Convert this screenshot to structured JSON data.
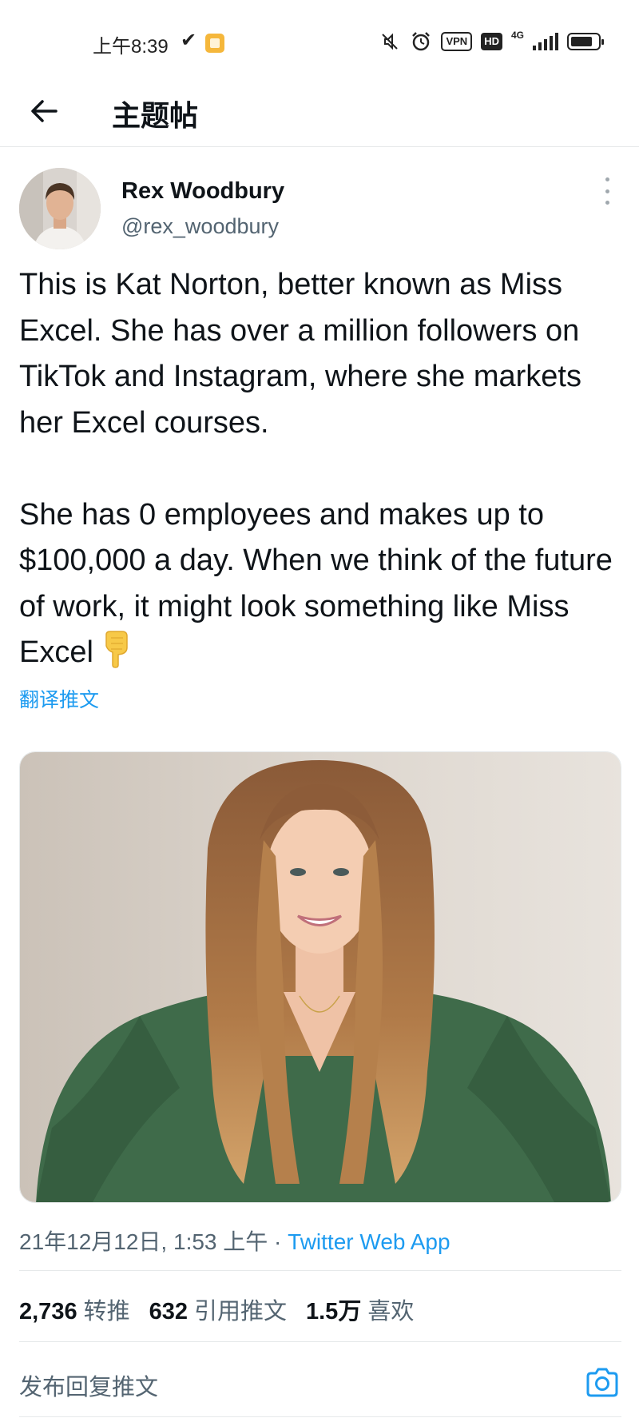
{
  "status_bar": {
    "time": "上午8:39",
    "check_mark": "✔",
    "icons": [
      "mute-icon",
      "alarm-icon",
      "vpn-icon",
      "hd-icon",
      "signal-icon",
      "battery-icon"
    ],
    "vpn_label": "VPN",
    "hd_label": "HD",
    "network_label": "4G"
  },
  "header": {
    "title": "主题帖"
  },
  "tweet": {
    "author_name": "Rex Woodbury",
    "author_handle": "@rex_woodbury",
    "text_p1": "This is Kat Norton, better known as Miss Excel. She has over a million followers on TikTok and Instagram, where she markets her Excel courses.",
    "text_p2": "She has 0 employees and makes up to $100,000 a day. When we think of the future of work, it might look something like Miss Excel",
    "emoji": "👇",
    "translate_label": "翻译推文",
    "timestamp": "21年12月12日, 1:53 上午 · ",
    "source": "Twitter Web App",
    "stats": {
      "retweets_count": "2,736",
      "retweets_label": "转推",
      "quotes_count": "632",
      "quotes_label": "引用推文",
      "likes_count": "1.5万",
      "likes_label": "喜欢"
    }
  },
  "reply": {
    "placeholder": "发布回复推文"
  },
  "colors": {
    "accent": "#1d9bf0",
    "text_primary": "#0f1419",
    "text_secondary": "#536471",
    "divider": "#e6e9ea"
  }
}
